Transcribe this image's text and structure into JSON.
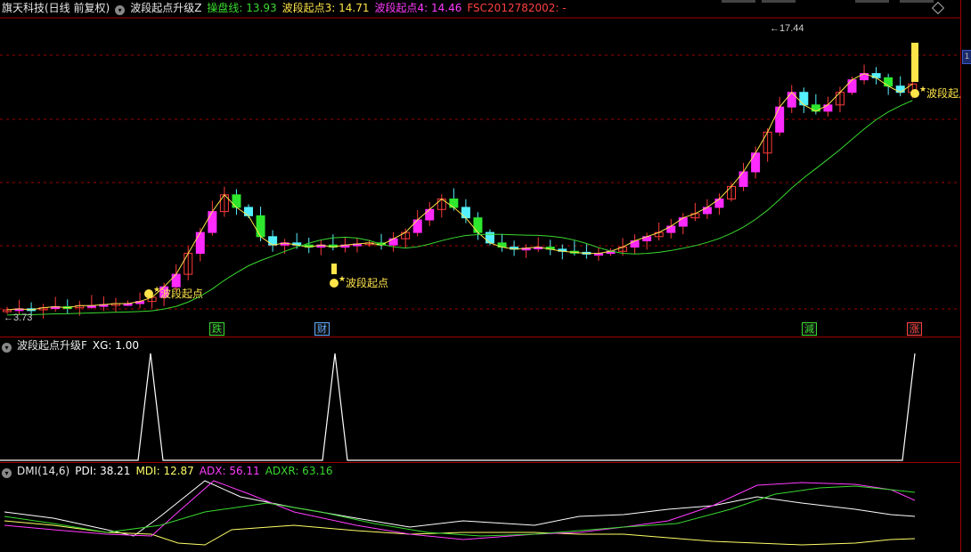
{
  "main": {
    "stock": "旗天科技(日线 前复权)",
    "indicator": "波段起点升级Z",
    "values": [
      {
        "label": "操盘线: 13.93",
        "color": "#39d92f"
      },
      {
        "label": "波段起点3: 14.71",
        "color": "#ffe44a"
      },
      {
        "label": "波段起点4: 14.46",
        "color": "#ff3cff"
      },
      {
        "label": "FSC2012782002: -",
        "color": "#ff4040"
      }
    ],
    "high_label": "17.44",
    "low_label": "3.73",
    "signal_text": "波段起点",
    "event_tags": [
      {
        "text": "跌",
        "color": "#39d92f"
      },
      {
        "text": "财",
        "color": "#5fa8ff"
      },
      {
        "text": "減",
        "color": "#39d92f"
      },
      {
        "text": "涨",
        "color": "#ff4040"
      }
    ],
    "scroll_label": "1"
  },
  "indicator1": {
    "title": "波段起点升级F",
    "values": [
      {
        "label": "XG: 1.00",
        "color": "#ffffff"
      }
    ]
  },
  "indicator2": {
    "title": "DMI(14,6)",
    "values": [
      {
        "label": "PDI: 38.21",
        "color": "#ffffff"
      },
      {
        "label": "MDI: 12.87",
        "color": "#ffff66"
      },
      {
        "label": "ADX: 56.11",
        "color": "#ff3cff"
      },
      {
        "label": "ADXR: 63.16",
        "color": "#39d92f"
      }
    ]
  },
  "colors": {
    "up_hollow": "#ff3b3b",
    "up_fill": "#ff2aff",
    "down_fill": "#55f0ff",
    "green_fill": "#2ee82e",
    "ma_line": "#39d92f",
    "signal": "#ffe44a",
    "grid": "#a00000"
  }
}
